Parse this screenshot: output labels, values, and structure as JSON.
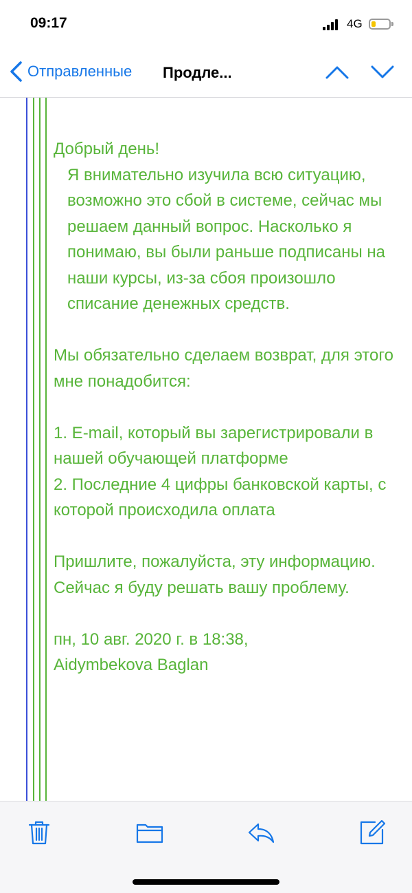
{
  "status": {
    "time": "09:17",
    "network": "4G"
  },
  "nav": {
    "back_label": "Отправленные",
    "title": "Продле..."
  },
  "colors": {
    "accent": "#1677e8",
    "quote_text": "#58b53a",
    "quote_bar_blue": "#3b4fd8",
    "quote_bar_green": "#58b53a",
    "battery": "#f5c400"
  },
  "message": {
    "greeting": "Добрый день!",
    "p1": "Я внимательно изучила всю ситуацию, возможно это сбой в системе, сейчас мы решаем данный вопрос. Насколько я понимаю, вы были раньше подписаны на наши курсы, из-за сбоя произошло списание денежных средств.",
    "p2": "Мы обязательно сделаем возврат, для этого мне понадобится:",
    "item1": "1. E-mail, который вы зарегистрировали в нашей обучающей платформе",
    "item2": "2. Последние 4 цифры банковской карты, с которой происходила оплата",
    "p3": "Пришлите, пожалуйста, эту информацию. Сейчас я буду решать вашу проблему.",
    "attribution_date": "пн, 10 авг. 2020 г. в 18:38,",
    "attribution_name": "Aidymbekova Baglan"
  },
  "toolbar": {
    "icons": [
      "trash-icon",
      "folder-icon",
      "reply-icon",
      "compose-icon"
    ]
  }
}
